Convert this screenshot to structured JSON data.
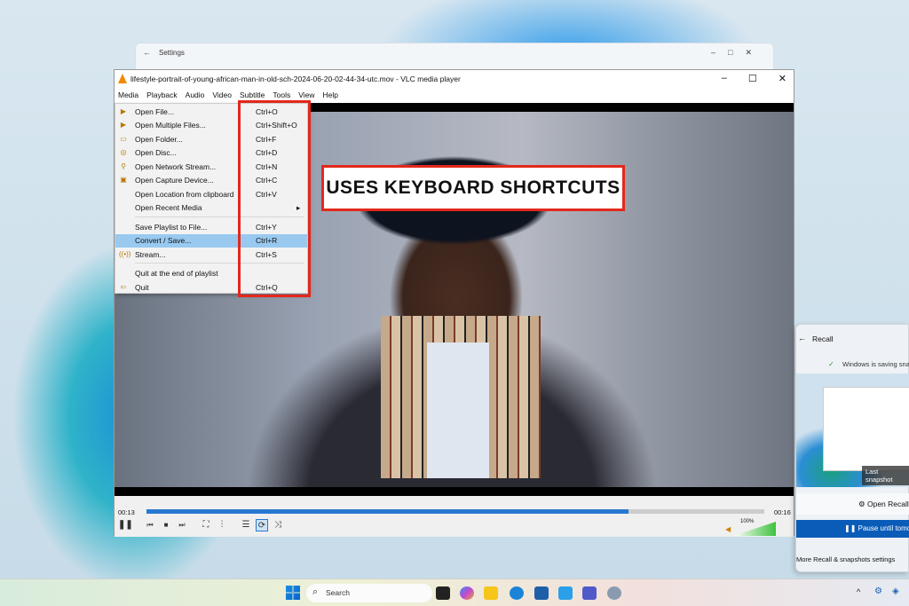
{
  "settings_window": {
    "title": "Settings",
    "back": "←",
    "controls": "–□✕"
  },
  "vlc": {
    "title": "lifestyle-portrait-of-young-african-man-in-old-sch-2024-06-20-02-44-34-utc.mov - VLC media player",
    "window_controls": [
      "–",
      "☐",
      "✕"
    ],
    "menu": [
      "Media",
      "Playback",
      "Audio",
      "Video",
      "Subtitle",
      "Tools",
      "View",
      "Help"
    ],
    "media_menu": [
      {
        "label": "Open File...",
        "shortcut": "Ctrl+O",
        "icon": "file-play-icon"
      },
      {
        "label": "Open Multiple Files...",
        "shortcut": "Ctrl+Shift+O",
        "icon": "files-icon"
      },
      {
        "label": "Open Folder...",
        "shortcut": "Ctrl+F",
        "icon": "folder-icon"
      },
      {
        "label": "Open Disc...",
        "shortcut": "Ctrl+D",
        "icon": "disc-icon"
      },
      {
        "label": "Open Network Stream...",
        "shortcut": "Ctrl+N",
        "icon": "network-icon"
      },
      {
        "label": "Open Capture Device...",
        "shortcut": "Ctrl+C",
        "icon": "capture-icon"
      },
      {
        "label": "Open Location from clipboard",
        "shortcut": "Ctrl+V",
        "icon": ""
      },
      {
        "label": "Open Recent Media",
        "shortcut": "▸",
        "icon": ""
      },
      {
        "label": "Save Playlist to File...",
        "shortcut": "Ctrl+Y",
        "icon": ""
      },
      {
        "label": "Convert / Save...",
        "shortcut": "Ctrl+R",
        "icon": ""
      },
      {
        "label": "Stream...",
        "shortcut": "Ctrl+S",
        "icon": "stream-icon"
      },
      {
        "label": "Quit at the end of playlist",
        "shortcut": "",
        "icon": ""
      },
      {
        "label": "Quit",
        "shortcut": "Ctrl+Q",
        "icon": "quit-icon"
      }
    ],
    "annotation": "USES KEYBOARD SHORTCUTS",
    "time_elapsed": "00:13",
    "time_total": "00:16",
    "progress": 0.78,
    "volume": "100%",
    "accent": "#2878d0"
  },
  "recall": {
    "title": "Recall",
    "status": "Windows is saving snapshots",
    "thumb_caption": "Last snapshot",
    "open_button": "Open Recall",
    "pause_button": "Pause until tomorrow",
    "more_link": "More Recall & snapshots settings"
  },
  "taskbar": {
    "search_placeholder": "Search"
  }
}
